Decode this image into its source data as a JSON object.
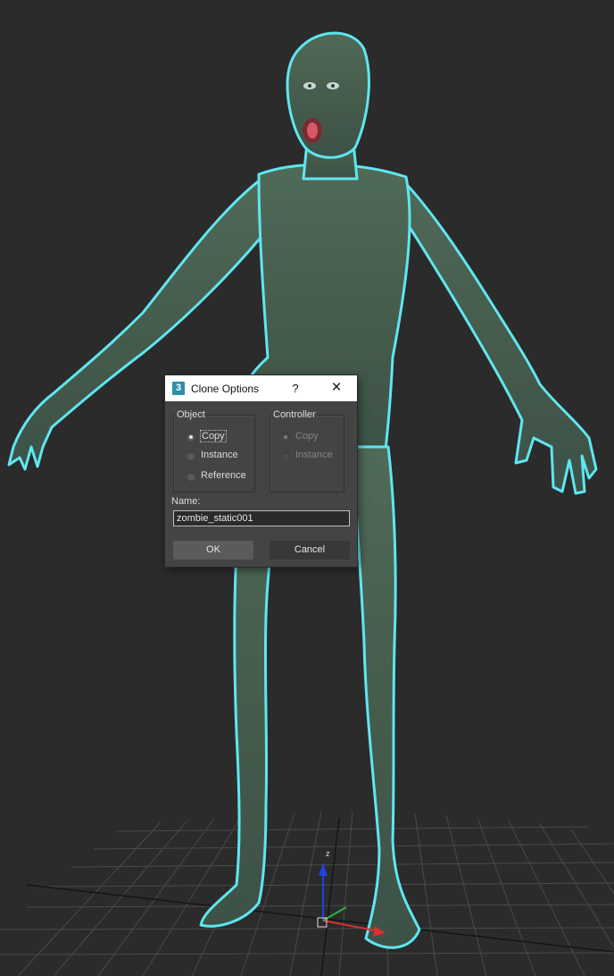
{
  "dialog": {
    "app_icon": "3",
    "title": "Clone Options",
    "help_label": "?",
    "close_label": "×",
    "object_group": {
      "label": "Object",
      "options": [
        "Copy",
        "Instance",
        "Reference"
      ],
      "selected": "Copy"
    },
    "controller_group": {
      "label": "Controller",
      "options": [
        "Copy",
        "Instance"
      ],
      "selected": "Copy",
      "disabled": true
    },
    "name_label": "Name:",
    "name_value": "zombie_static001",
    "ok_label": "OK",
    "cancel_label": "Cancel"
  },
  "viewport": {
    "gizmo_axis_label": "z",
    "colors": {
      "background": "#2b2b2b",
      "grid": "#4a4a4a",
      "selection_outline": "#5fe6f0",
      "model_skin": "#4a6150",
      "axis_x": "#d93030",
      "axis_y": "#30b040",
      "axis_z": "#2040e0"
    }
  }
}
